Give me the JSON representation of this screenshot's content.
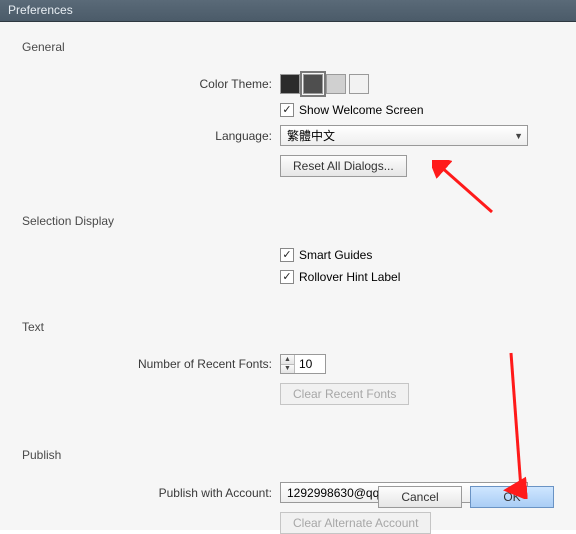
{
  "title": "Preferences",
  "general": {
    "heading": "General",
    "color_theme_label": "Color Theme:",
    "show_welcome_label": "Show Welcome Screen",
    "language_label": "Language:",
    "language_value": "繁體中文",
    "reset_dialogs_label": "Reset All Dialogs..."
  },
  "selection": {
    "heading": "Selection Display",
    "smart_guides_label": "Smart Guides",
    "rollover_label": "Rollover Hint Label"
  },
  "text": {
    "heading": "Text",
    "recent_fonts_label": "Number of Recent Fonts:",
    "recent_fonts_value": "10",
    "clear_fonts_label": "Clear Recent Fonts"
  },
  "publish": {
    "heading": "Publish",
    "account_label": "Publish with Account:",
    "account_value": "1292998630@qq.com - AdobeID",
    "clear_account_label": "Clear Alternate Account"
  },
  "footer": {
    "cancel": "Cancel",
    "ok": "OK"
  }
}
